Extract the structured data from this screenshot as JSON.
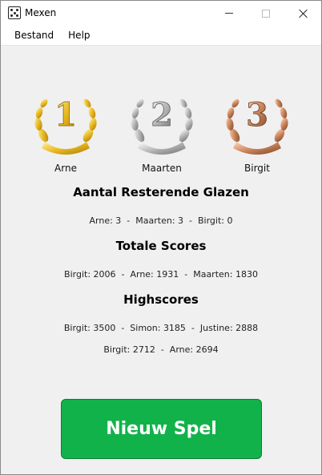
{
  "window": {
    "title": "Mexen"
  },
  "menu": {
    "items": [
      "Bestand",
      "Help"
    ]
  },
  "podium": [
    {
      "rank": "1",
      "name": "Arne",
      "medal": "gold",
      "color": "#e8b820"
    },
    {
      "rank": "2",
      "name": "Maarten",
      "medal": "silver",
      "color": "#b5b5b5"
    },
    {
      "rank": "3",
      "name": "Birgit",
      "medal": "bronze",
      "color": "#c9835a"
    }
  ],
  "sections": {
    "glasses_title": "Aantal Resterende Glazen",
    "glasses_line": "Arne: 3  -  Maarten: 3  -  Birgit: 0",
    "totals_title": "Totale Scores",
    "totals_line": "Birgit: 2006  -  Arne: 1931  -  Maarten: 1830",
    "highscores_title": "Highscores",
    "highscores_line1": "Birgit: 3500  -  Simon: 3185  -  Justine: 2888",
    "highscores_line2": "Birgit: 2712  -  Arne: 2694"
  },
  "actions": {
    "new_game_label": "Nieuw Spel",
    "new_game_color": "#12b24a"
  }
}
